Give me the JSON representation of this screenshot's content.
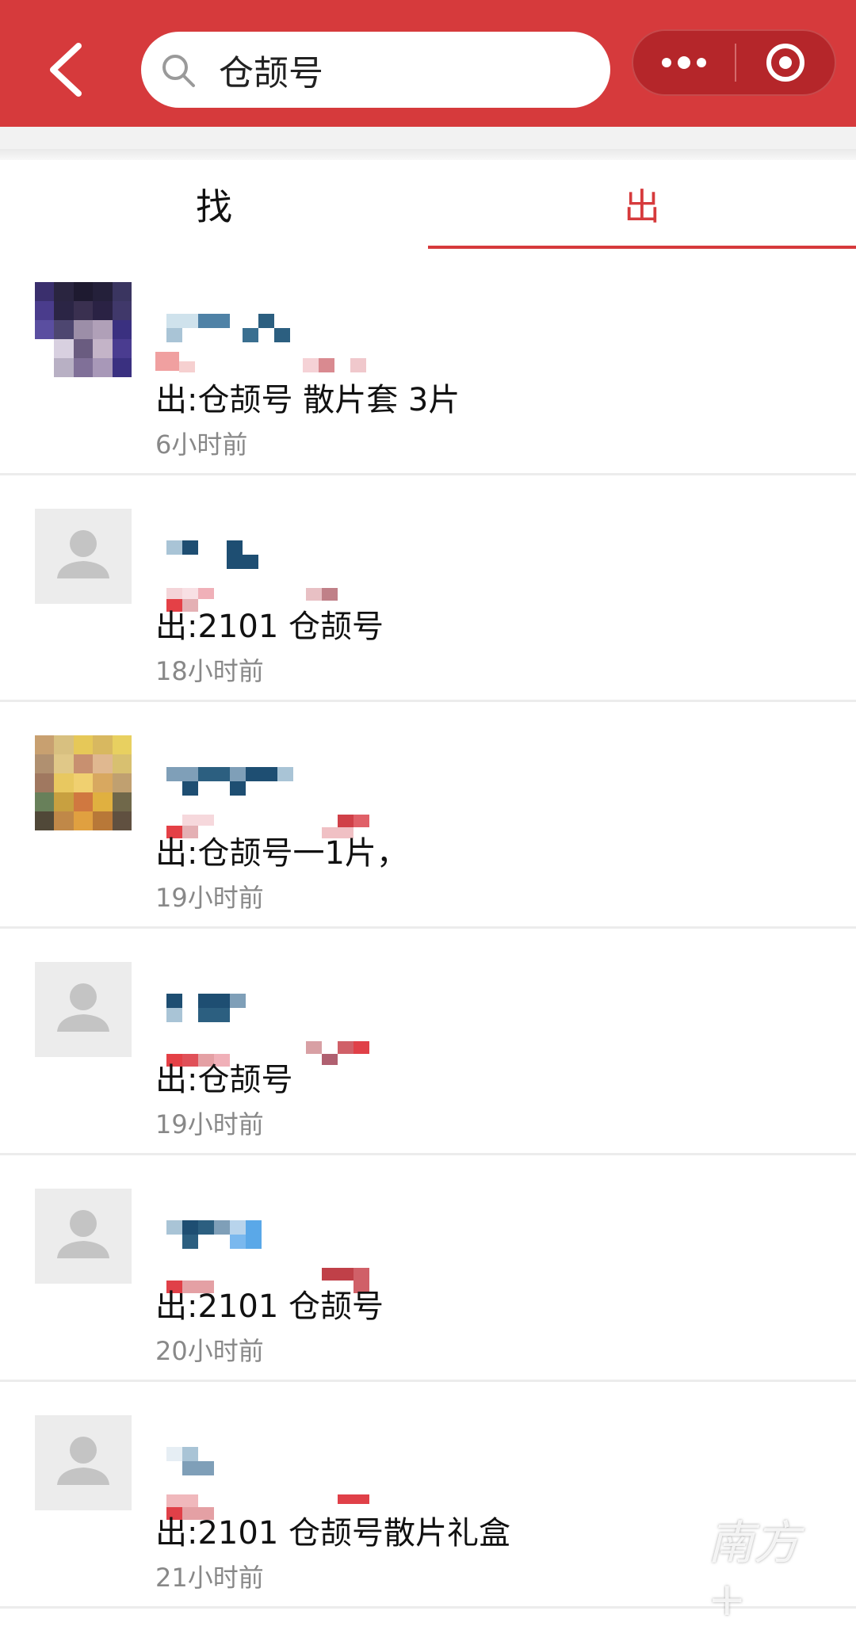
{
  "header": {
    "search_text": "仓颉号",
    "accent_color": "#d63a3c"
  },
  "tabs": [
    {
      "label": "找",
      "active": false
    },
    {
      "label": "出",
      "active": true
    }
  ],
  "items": [
    {
      "avatar": "photo-avatar",
      "message": "出:仓颉号 散片套 3片",
      "time": "6小时前"
    },
    {
      "avatar": "default-avatar",
      "message": "出:2101 仓颉号",
      "time": "18小时前"
    },
    {
      "avatar": "photo-avatar",
      "message": "出:仓颉号一1片，",
      "time": "19小时前"
    },
    {
      "avatar": "default-avatar",
      "message": "出:仓颉号",
      "time": "19小时前"
    },
    {
      "avatar": "default-avatar",
      "message": "出:2101 仓颉号",
      "time": "20小时前"
    },
    {
      "avatar": "default-avatar",
      "message": "出:2101 仓颉号散片礼盒",
      "time": "21小时前"
    }
  ],
  "watermark": "南方+"
}
